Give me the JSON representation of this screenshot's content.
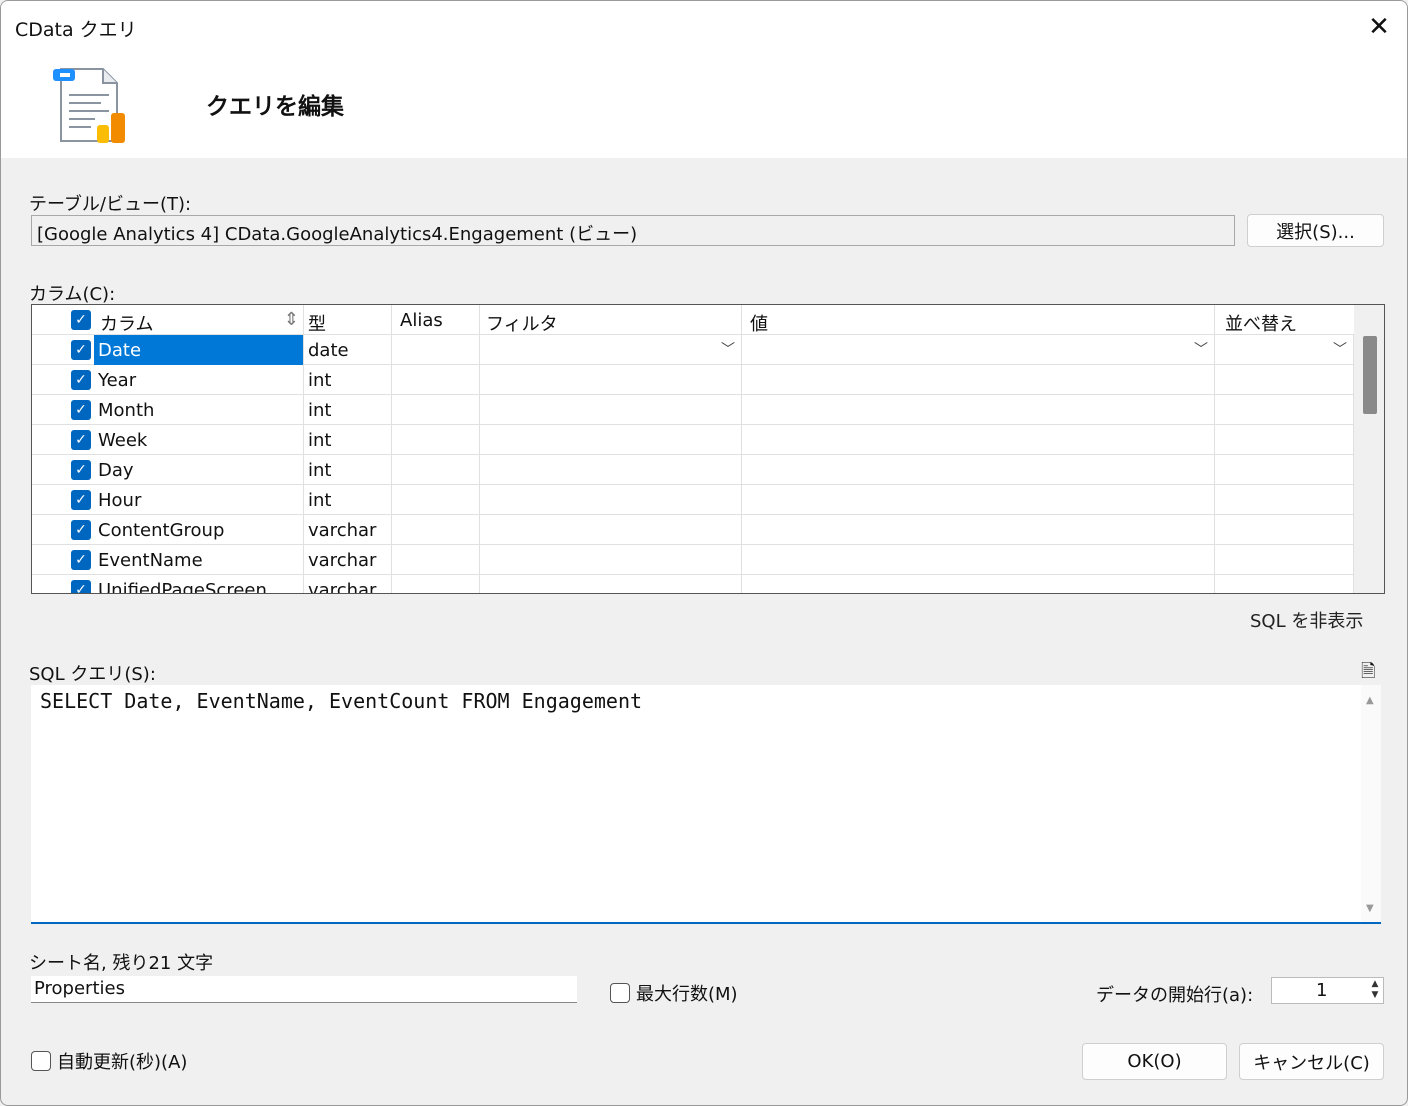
{
  "window": {
    "title": "CData クエリ",
    "heading": "クエリを編集"
  },
  "table": {
    "label": "テーブル/ビュー(T):",
    "value": "[Google Analytics 4] CData.GoogleAnalytics4.Engagement (ビュー)",
    "select_button": "選択(S)..."
  },
  "columns": {
    "label": "カラム(C):",
    "headers": [
      "カラム",
      "型",
      "Alias",
      "フィルタ",
      "値",
      "並べ替え"
    ],
    "rows": [
      {
        "name": "Date",
        "type": "date",
        "checked": true,
        "selected": true
      },
      {
        "name": "Year",
        "type": "int",
        "checked": true
      },
      {
        "name": "Month",
        "type": "int",
        "checked": true
      },
      {
        "name": "Week",
        "type": "int",
        "checked": true
      },
      {
        "name": "Day",
        "type": "int",
        "checked": true
      },
      {
        "name": "Hour",
        "type": "int",
        "checked": true
      },
      {
        "name": "ContentGroup",
        "type": "varchar",
        "checked": true
      },
      {
        "name": "EventName",
        "type": "varchar",
        "checked": true
      },
      {
        "name": "UnifiedPageScreen",
        "type": "varchar",
        "checked": true
      }
    ]
  },
  "sql": {
    "toggle_link": "SQL を非表示",
    "label": "SQL クエリ(S):",
    "query": "SELECT Date, EventName, EventCount FROM Engagement"
  },
  "sheet": {
    "label": "シート名, 残り21 文字",
    "value": "Properties"
  },
  "max_rows": {
    "label": "最大行数(M)",
    "checked": false
  },
  "start_row": {
    "label": "データの開始行(a):",
    "value": "1"
  },
  "auto_refresh": {
    "label": "自動更新(秒)(A)",
    "checked": false
  },
  "buttons": {
    "ok": "OK(O)",
    "cancel": "キャンセル(C)"
  },
  "colors": {
    "accent": "#0067c0"
  }
}
